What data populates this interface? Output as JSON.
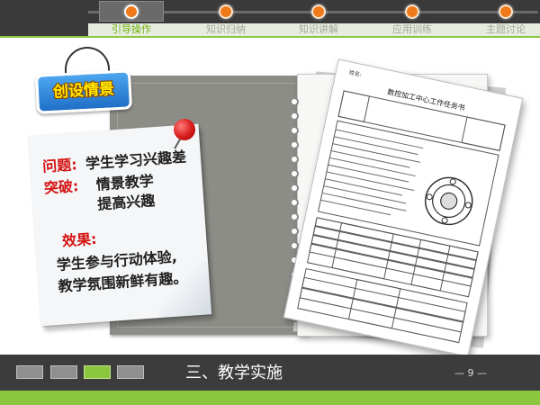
{
  "nav": {
    "items": [
      {
        "label": "引导操作",
        "active": true
      },
      {
        "label": "知识归纳",
        "active": false
      },
      {
        "label": "知识讲解",
        "active": false
      },
      {
        "label": "应用训练",
        "active": false
      },
      {
        "label": "主题讨论",
        "active": false
      }
    ]
  },
  "badge": {
    "text": "创设情景"
  },
  "card": {
    "problem_label": "问题:",
    "problem_text": "学生学习兴趣差",
    "breakthrough_label": "突破:",
    "breakthrough_line1": "情景教学",
    "breakthrough_line2": "提高兴趣",
    "effect_label": "效果:",
    "effect_line1": "学生参与行动体验,",
    "effect_line2": "教学氛围新鲜有趣。"
  },
  "document": {
    "author_label": "姓名:",
    "title": "数控加工中心工作任务书"
  },
  "footer": {
    "section_title": "三、教学实施",
    "page_number": "— 9 —",
    "segments": [
      {
        "active": false
      },
      {
        "active": false
      },
      {
        "active": true
      },
      {
        "active": false
      }
    ]
  },
  "colors": {
    "accent_green": "#8cc63f",
    "nav_dot_orange": "#f07a1a",
    "dark_bar": "#3c3c3c",
    "card_red_text": "#d41313",
    "badge_blue": "#2b86d8",
    "badge_yellow_text": "#ffe800"
  },
  "icons": [
    "pushpin-icon",
    "nav-progress-dot-icon"
  ]
}
